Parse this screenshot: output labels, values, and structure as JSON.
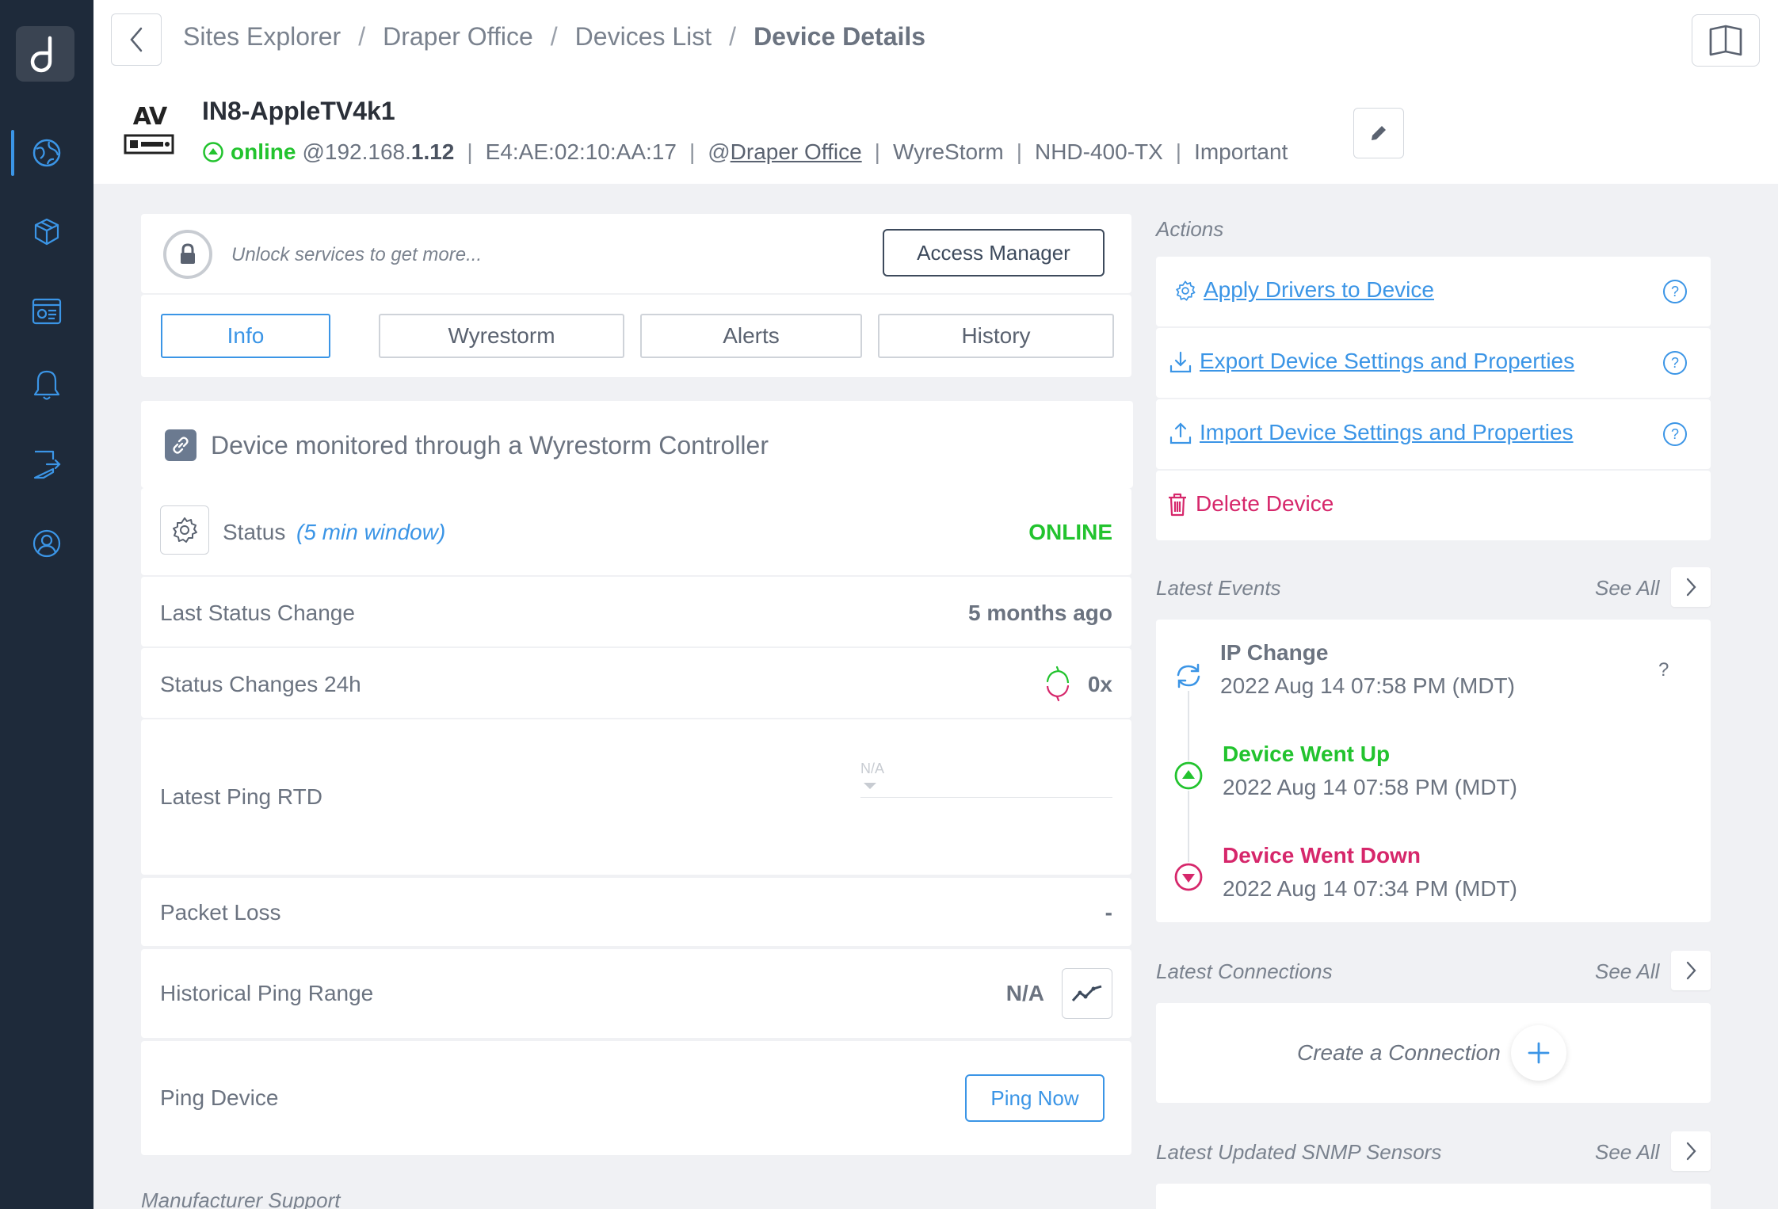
{
  "app": {
    "logo_letter": "d"
  },
  "sidebar": {
    "items": [
      {
        "icon": "globe-icon"
      },
      {
        "icon": "cubes-icon"
      },
      {
        "icon": "dashboard-icon"
      },
      {
        "icon": "bell-icon"
      },
      {
        "icon": "shield-arrow-icon"
      },
      {
        "icon": "user-circle-icon"
      }
    ]
  },
  "breadcrumb": {
    "items": [
      "Sites Explorer",
      "Draper Office",
      "Devices List"
    ],
    "current": "Device Details",
    "separator": "/"
  },
  "device": {
    "type_label": "AV",
    "name": "IN8-AppleTV4k1",
    "status": "online",
    "ip_prefix": "@192.168.",
    "ip_suffix": "1.12",
    "mac": "E4:AE:02:10:AA:17",
    "site_prefix": "@",
    "site": "Draper Office",
    "manufacturer": "WyreStorm",
    "model": "NHD-400-TX",
    "priority": "Important"
  },
  "services": {
    "unlock_text": "Unlock services to get more...",
    "access_button": "Access Manager"
  },
  "tabs": [
    {
      "label": "Info",
      "active": true
    },
    {
      "label": "Wyrestorm",
      "active": false
    },
    {
      "label": "Alerts",
      "active": false
    },
    {
      "label": "History",
      "active": false
    }
  ],
  "info": {
    "monitored_text": "Device monitored through a Wyrestorm Controller",
    "status_label": "Status",
    "status_window": "(5 min window)",
    "status_value": "ONLINE",
    "last_change_label": "Last Status Change",
    "last_change_value": "5 months ago",
    "changes_label": "Status Changes 24h",
    "changes_value": "0x",
    "ping_rtd_label": "Latest Ping RTD",
    "ping_rtd_value": "N/A",
    "packet_loss_label": "Packet Loss",
    "packet_loss_value": "-",
    "hist_ping_label": "Historical Ping Range",
    "hist_ping_value": "N/A",
    "ping_device_label": "Ping Device",
    "ping_button": "Ping Now",
    "manufacturer_support_label": "Manufacturer Support"
  },
  "actions": {
    "title": "Actions",
    "items": [
      {
        "label": "Apply Drivers to Device",
        "icon": "gear-icon"
      },
      {
        "label": "Export Device Settings and Properties",
        "icon": "download-icon"
      },
      {
        "label": "Import Device Settings and Properties",
        "icon": "upload-icon"
      }
    ],
    "delete_label": "Delete Device"
  },
  "latest_events": {
    "title": "Latest Events",
    "see_all": "See All",
    "events": [
      {
        "title": "IP Change",
        "time": "2022 Aug 14 07:58 PM (MDT)",
        "extra": "?"
      },
      {
        "title": "Device Went Up",
        "time": "2022 Aug 14 07:58 PM (MDT)"
      },
      {
        "title": "Device Went Down",
        "time": "2022 Aug 14 07:34 PM (MDT)"
      }
    ]
  },
  "latest_connections": {
    "title": "Latest Connections",
    "see_all": "See All",
    "create_label": "Create a Connection"
  },
  "snmp": {
    "title": "Latest Updated SNMP Sensors",
    "see_all": "See All"
  },
  "colors": {
    "sidebar_bg": "#1e2a3a",
    "accent": "#3b95e6",
    "online": "#22c32e",
    "danger": "#d6276b"
  }
}
